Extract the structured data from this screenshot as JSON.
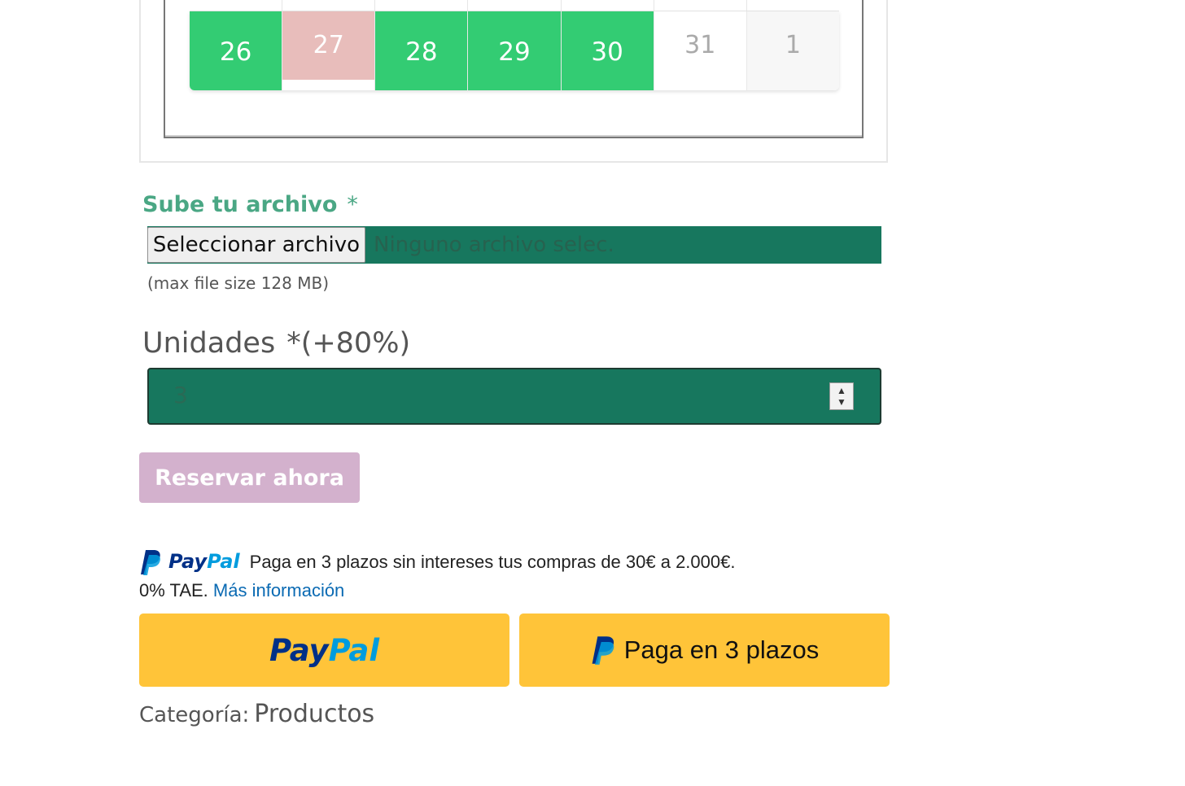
{
  "calendar": {
    "days": [
      {
        "label": "26",
        "state": "available"
      },
      {
        "label": "27",
        "state": "booked"
      },
      {
        "label": "28",
        "state": "available"
      },
      {
        "label": "29",
        "state": "available"
      },
      {
        "label": "30",
        "state": "available"
      },
      {
        "label": "31",
        "state": "unavailable"
      },
      {
        "label": "1",
        "state": "next-month"
      }
    ],
    "colors": {
      "available": "#33cc73",
      "booked": "#e8bdbb"
    }
  },
  "upload": {
    "label": "Sube tu archivo",
    "required_mark": "*",
    "button_label": "Seleccionar archivo",
    "status": "Ninguno archivo selec.",
    "max_size": "(max file size 128 MB)"
  },
  "units": {
    "label": "Unidades",
    "required_mark": "*",
    "modifier": "(+80%)",
    "value": "3"
  },
  "reserve": {
    "label": "Reservar ahora"
  },
  "paypal": {
    "logo_pay": "Pay",
    "logo_pal": "Pal",
    "message": "Paga en 3 plazos sin intereses tus compras de 30€ a 2.000€.",
    "apr": "0% TAE.",
    "more_info": "Más información",
    "button_pay_later": "Paga en 3 plazos",
    "brand_dark": "#003087",
    "brand_light": "#009cde",
    "button_color": "#ffc439"
  },
  "category": {
    "label": "Categoría:",
    "value": "Productos"
  }
}
